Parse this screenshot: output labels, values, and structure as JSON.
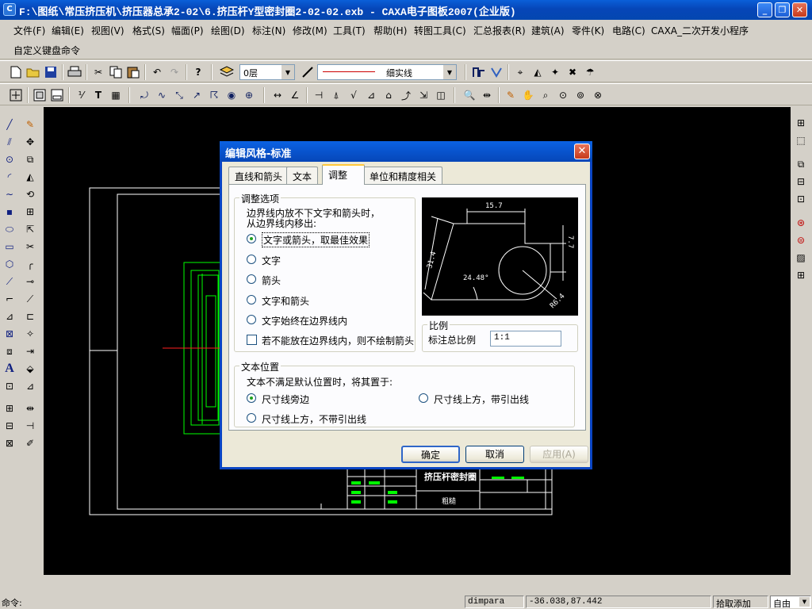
{
  "window": {
    "title": "F:\\图纸\\常压挤压机\\挤压器总承2-02\\6.挤压杆Y型密封圈2-02-02.exb - CAXA电子图板2007(企业版)"
  },
  "menu": {
    "items": [
      "文件(F)",
      "编辑(E)",
      "视图(V)",
      "格式(S)",
      "幅面(P)",
      "绘图(D)",
      "标注(N)",
      "修改(M)",
      "工具(T)",
      "帮助(H)",
      "转图工具(C)",
      "汇总报表(R)",
      "建筑(A)",
      "零件(K)",
      "电路(C)",
      "CAXA_二次开发小程序"
    ],
    "custom": "自定义键盘命令"
  },
  "toolbar": {
    "layer_value": "0层",
    "linetype_value": "细实线",
    "linetype_color": "#cc0000"
  },
  "dialog": {
    "title": "编辑风格-标准",
    "tabs": [
      "直线和箭头",
      "文本",
      "调整",
      "单位和精度相关"
    ],
    "adjust": {
      "group_label": "调整选项",
      "desc_line1": "边界线内放不下文字和箭头时，",
      "desc_line2": "从边界线内移出:",
      "options": [
        "文字或箭头，取最佳效果",
        "文字",
        "箭头",
        "文字和箭头",
        "文字始终在边界线内"
      ],
      "selected_index": 0,
      "checkbox_label": "若不能放在边界线内，则不绘制箭头",
      "checkbox_checked": false
    },
    "preview": {
      "dims": [
        "15.7",
        "7.7",
        "31.4",
        "24.48°",
        "R6.4"
      ]
    },
    "scale": {
      "group_label": "比例",
      "label": "标注总比例",
      "value": "1:1"
    },
    "text_pos": {
      "group_label": "文本位置",
      "desc": "文本不满足默认位置时，将其置于:",
      "options": [
        "尺寸线旁边",
        "尺寸线上方，带引出线",
        "尺寸线上方，不带引出线"
      ],
      "selected_index": 0
    },
    "buttons": {
      "ok": "确定",
      "cancel": "取消",
      "apply": "应用(A)"
    }
  },
  "drawing": {
    "title_block_name": "挤压杆密封圈",
    "title_block_sub": "粗糙"
  },
  "command": {
    "prompt": "命令:"
  },
  "status": {
    "cmd_name": "dimpara",
    "coords": "-36.038,87.442",
    "snap_label": "拾取添加",
    "snap_mode": "自由"
  }
}
